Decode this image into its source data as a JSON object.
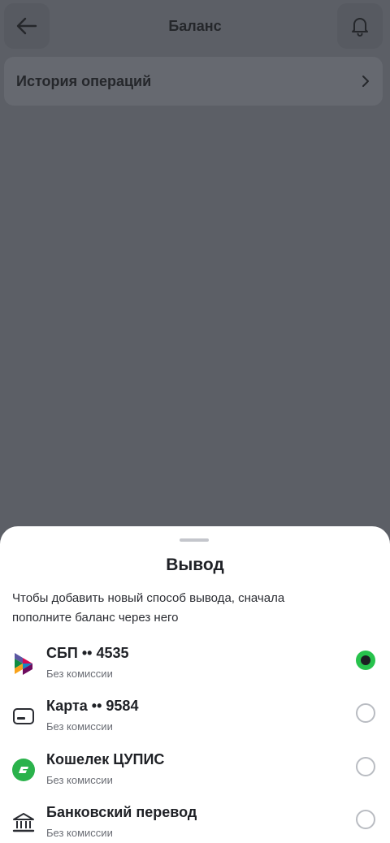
{
  "header": {
    "title": "Баланс",
    "back_icon": "arrow-left-icon",
    "bell_icon": "bell-icon"
  },
  "history": {
    "label": "История операций",
    "chevron_icon": "chevron-right-icon"
  },
  "sheet": {
    "title": "Вывод",
    "note": "Чтобы добавить новый способ вывода, сначала пополните баланс через него",
    "methods": [
      {
        "name": "СБП •• 4535",
        "sub": "Без комиссии",
        "icon": "sbp-logo-icon",
        "selected": true
      },
      {
        "name": "Карта •• 9584",
        "sub": "Без комиссии",
        "icon": "card-icon",
        "selected": false
      },
      {
        "name": "Кошелек ЦУПИС",
        "sub": "Без комиссии",
        "icon": "cupis-wallet-icon",
        "selected": false
      },
      {
        "name": "Банковский перевод",
        "sub": "Без комиссии",
        "icon": "bank-icon",
        "selected": false
      }
    ]
  },
  "colors": {
    "overlay": "#5c5f66",
    "accent_green": "#27c24c",
    "sheet_bg": "#ffffff"
  }
}
